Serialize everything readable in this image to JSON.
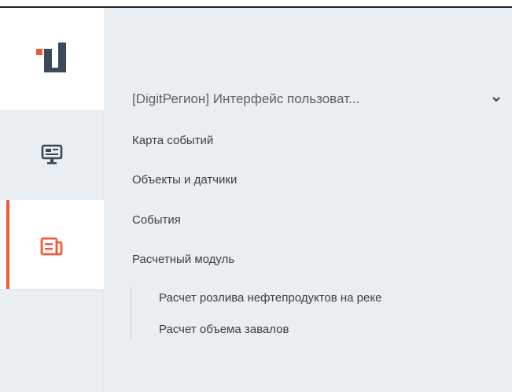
{
  "colors": {
    "accent": "#ef5a3b",
    "logo_dark": "#3b4a5a",
    "logo_orange": "#ef5a3b",
    "panel_bg": "#e9eef2"
  },
  "rail": {
    "items": [
      {
        "name": "monitor",
        "icon": "monitor-icon",
        "active": false
      },
      {
        "name": "reports",
        "icon": "report-icon",
        "active": true
      }
    ]
  },
  "project": {
    "label": "[DigitРегион] Интерфейс пользоват...",
    "icon": "chevron-down-icon"
  },
  "menu": {
    "items": [
      "Карта событий",
      "Объекты и датчики",
      "События",
      "Расчетный модуль"
    ],
    "subitems": [
      "Расчет розлива нефтепродуктов на реке",
      "Расчет объема завалов"
    ]
  }
}
